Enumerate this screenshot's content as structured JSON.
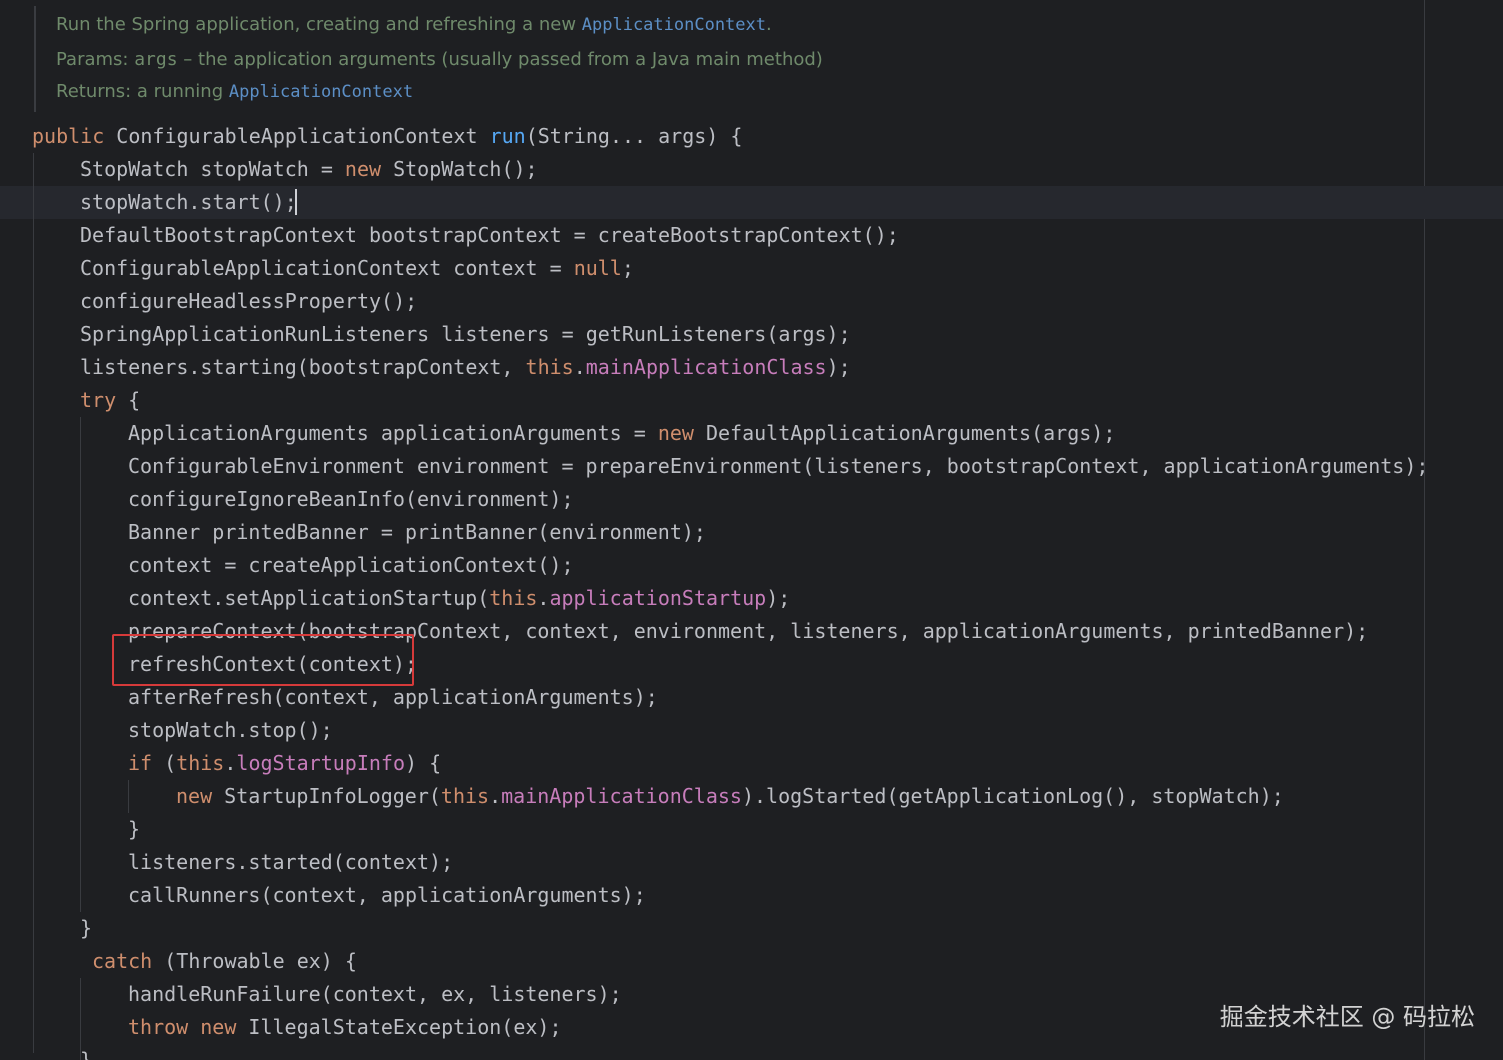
{
  "doc": {
    "summary_text": "Run the Spring application, creating and refreshing a new ",
    "summary_code": "ApplicationContext",
    "summary_end": ".",
    "params_label": "Params:",
    "params_name": "args",
    "params_desc": " – the application arguments (usually passed from a Java main method)",
    "returns_label": "Returns:",
    "returns_desc": " a running ",
    "returns_code": "ApplicationContext"
  },
  "code": {
    "lines": [
      [
        {
          "t": "public",
          "c": "kw"
        },
        {
          "t": " ConfigurableApplicationContext ",
          "c": ""
        },
        {
          "t": "run",
          "c": "fn"
        },
        {
          "t": "(String... args) {",
          "c": ""
        }
      ],
      [
        {
          "t": "StopWatch stopWatch = ",
          "c": ""
        },
        {
          "t": "new",
          "c": "kw"
        },
        {
          "t": " StopWatch();",
          "c": ""
        }
      ],
      [
        {
          "t": "stopWatch.start();",
          "c": ""
        }
      ],
      [
        {
          "t": "DefaultBootstrapContext bootstrapContext = createBootstrapContext();",
          "c": ""
        }
      ],
      [
        {
          "t": "ConfigurableApplicationContext context = ",
          "c": ""
        },
        {
          "t": "null",
          "c": "kw"
        },
        {
          "t": ";",
          "c": ""
        }
      ],
      [
        {
          "t": "configureHeadlessProperty();",
          "c": ""
        }
      ],
      [
        {
          "t": "SpringApplicationRunListeners listeners = getRunListeners(args);",
          "c": ""
        }
      ],
      [
        {
          "t": "listeners.starting(bootstrapContext, ",
          "c": ""
        },
        {
          "t": "this",
          "c": "kw"
        },
        {
          "t": ".",
          "c": ""
        },
        {
          "t": "mainApplicationClass",
          "c": "fld"
        },
        {
          "t": ");",
          "c": ""
        }
      ],
      [
        {
          "t": "try",
          "c": "kw"
        },
        {
          "t": " {",
          "c": ""
        }
      ],
      [
        {
          "t": "ApplicationArguments applicationArguments = ",
          "c": ""
        },
        {
          "t": "new",
          "c": "kw"
        },
        {
          "t": " DefaultApplicationArguments(args);",
          "c": ""
        }
      ],
      [
        {
          "t": "ConfigurableEnvironment environment = prepareEnvironment(listeners, bootstrapContext, applicationArguments);",
          "c": ""
        }
      ],
      [
        {
          "t": "configureIgnoreBeanInfo(environment);",
          "c": ""
        }
      ],
      [
        {
          "t": "Banner printedBanner = printBanner(environment);",
          "c": ""
        }
      ],
      [
        {
          "t": "context = createApplicationContext();",
          "c": ""
        }
      ],
      [
        {
          "t": "context.setApplicationStartup(",
          "c": ""
        },
        {
          "t": "this",
          "c": "kw"
        },
        {
          "t": ".",
          "c": ""
        },
        {
          "t": "applicationStartup",
          "c": "fld"
        },
        {
          "t": ");",
          "c": ""
        }
      ],
      [
        {
          "t": "prepareContext(bootstrapContext, context, environment, listeners, applicationArguments, printedBanner);",
          "c": ""
        }
      ],
      [
        {
          "t": "refreshContext(context);",
          "c": ""
        }
      ],
      [
        {
          "t": "afterRefresh(context, applicationArguments);",
          "c": ""
        }
      ],
      [
        {
          "t": "stopWatch.stop();",
          "c": ""
        }
      ],
      [
        {
          "t": "if",
          "c": "kw"
        },
        {
          "t": " (",
          "c": ""
        },
        {
          "t": "this",
          "c": "kw"
        },
        {
          "t": ".",
          "c": ""
        },
        {
          "t": "logStartupInfo",
          "c": "fld"
        },
        {
          "t": ") {",
          "c": ""
        }
      ],
      [
        {
          "t": "new",
          "c": "kw"
        },
        {
          "t": " StartupInfoLogger(",
          "c": ""
        },
        {
          "t": "this",
          "c": "kw"
        },
        {
          "t": ".",
          "c": ""
        },
        {
          "t": "mainApplicationClass",
          "c": "fld"
        },
        {
          "t": ").logStarted(getApplicationLog(), stopWatch);",
          "c": ""
        }
      ],
      [
        {
          "t": "}",
          "c": ""
        }
      ],
      [
        {
          "t": "listeners.started(context);",
          "c": ""
        }
      ],
      [
        {
          "t": "callRunners(context, applicationArguments);",
          "c": ""
        }
      ],
      [
        {
          "t": "}",
          "c": ""
        }
      ],
      [
        {
          "t": "catch",
          "c": "kw"
        },
        {
          "t": " (Throwable ex) {",
          "c": ""
        }
      ],
      [
        {
          "t": "handleRunFailure(context, ex, listeners);",
          "c": ""
        }
      ],
      [
        {
          "t": "throw",
          "c": "kw"
        },
        {
          "t": " ",
          "c": ""
        },
        {
          "t": "new",
          "c": "kw"
        },
        {
          "t": " IllegalStateException(ex);",
          "c": ""
        }
      ],
      [
        {
          "t": "}",
          "c": ""
        }
      ]
    ]
  },
  "watermark": "掘金技术社区 @ 码拉松",
  "colors": {
    "background": "#1e1f22",
    "keyword": "#cf8e6d",
    "field": "#c77dbb",
    "method_decl": "#56a8f5",
    "doc_text": "#6f8a6b",
    "doc_code": "#5c8fc6",
    "highlight_box": "#d63a3a"
  }
}
